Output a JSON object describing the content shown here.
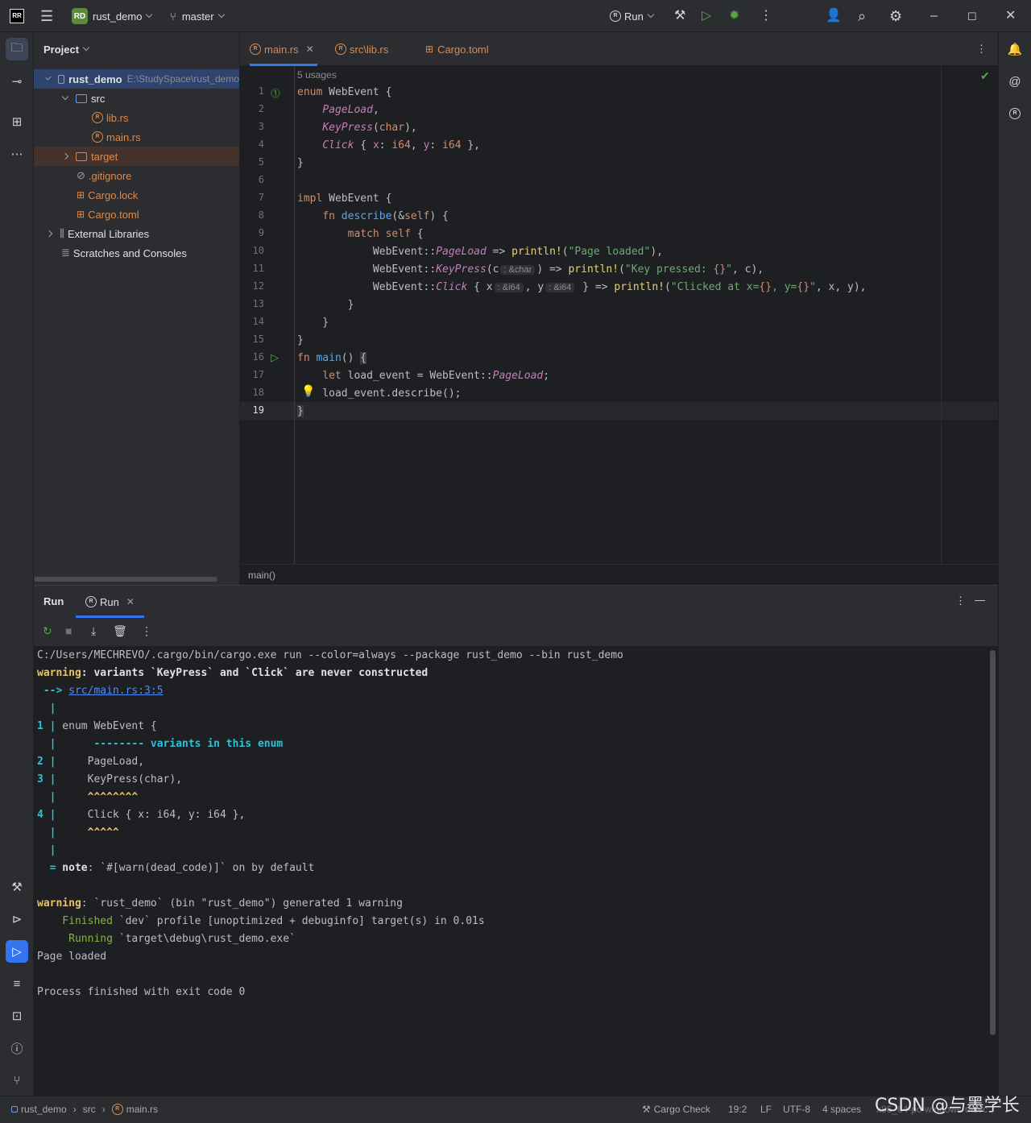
{
  "titlebar": {
    "logo": "RR",
    "project_badge": "RD",
    "project_name": "rust_demo",
    "branch": "master",
    "run_label": "Run"
  },
  "project_panel": {
    "title": "Project",
    "root_name": "rust_demo",
    "root_path": "E:\\StudySpace\\rust_demo",
    "items": [
      {
        "label": "src"
      },
      {
        "label": "lib.rs"
      },
      {
        "label": "main.rs"
      },
      {
        "label": "target"
      },
      {
        "label": ".gitignore"
      },
      {
        "label": "Cargo.lock"
      },
      {
        "label": "Cargo.toml"
      },
      {
        "label": "External Libraries"
      },
      {
        "label": "Scratches and Consoles"
      }
    ]
  },
  "editor": {
    "tabs": [
      {
        "label": "main.rs"
      },
      {
        "label": "src\\lib.rs"
      },
      {
        "label": "Cargo.toml"
      }
    ],
    "usages": "5 usages",
    "line_numbers": [
      "1",
      "2",
      "3",
      "4",
      "5",
      "6",
      "7",
      "8",
      "9",
      "10",
      "11",
      "12",
      "13",
      "14",
      "15",
      "16",
      "17",
      "18",
      "19"
    ],
    "breadcrumb": "main()"
  },
  "run_panel": {
    "title": "Run",
    "tab_label": "Run",
    "console": {
      "cmd": "C:/Users/MECHREVO/.cargo/bin/cargo.exe run --color=always --package rust_demo --bin rust_demo",
      "w1_label": "warning",
      "w1_text": ": variants `KeyPress` and `Click` are never constructed",
      "arrow": " -->",
      "link": "src/main.rs:3:5",
      "pipe": "  |",
      "l1_num": "1 |",
      "l1_code": " enum WebEvent {",
      "l1_marker": "      -------- variants in this enum",
      "l2_num": "2 |",
      "l2_code": "     PageLoad,",
      "l3_num": "3 |",
      "l3_code": "     KeyPress(char),",
      "l3_marker": "     ^^^^^^^^",
      "l4_num": "4 |",
      "l4_code": "     Click { x: i64, y: i64 },",
      "l4_marker": "     ^^^^^",
      "note_eq": "  =",
      "note_label": " note",
      "note_text": ": `#[warn(dead_code)]` on by default",
      "w2_label": "warning",
      "w2_text": ": `rust_demo` (bin \"rust_demo\") generated 1 warning",
      "fin_label": "    Finished",
      "fin_text": " `dev` profile [unoptimized + debuginfo] target(s) in 0.01s",
      "run_label": "     Running",
      "run_text": " `target\\debug\\rust_demo.exe`",
      "output": "Page loaded",
      "exit": "Process finished with exit code 0"
    }
  },
  "statusbar": {
    "path": [
      "rust_demo",
      "src",
      "main.rs"
    ],
    "cargo_check": "Cargo Check",
    "position": "19:2",
    "line_ending": "LF",
    "encoding": "UTF-8",
    "indent": "4 spaces",
    "toolchain": "x86_64-pc-windows-msvc"
  },
  "watermark": "CSDN @与墨学长"
}
